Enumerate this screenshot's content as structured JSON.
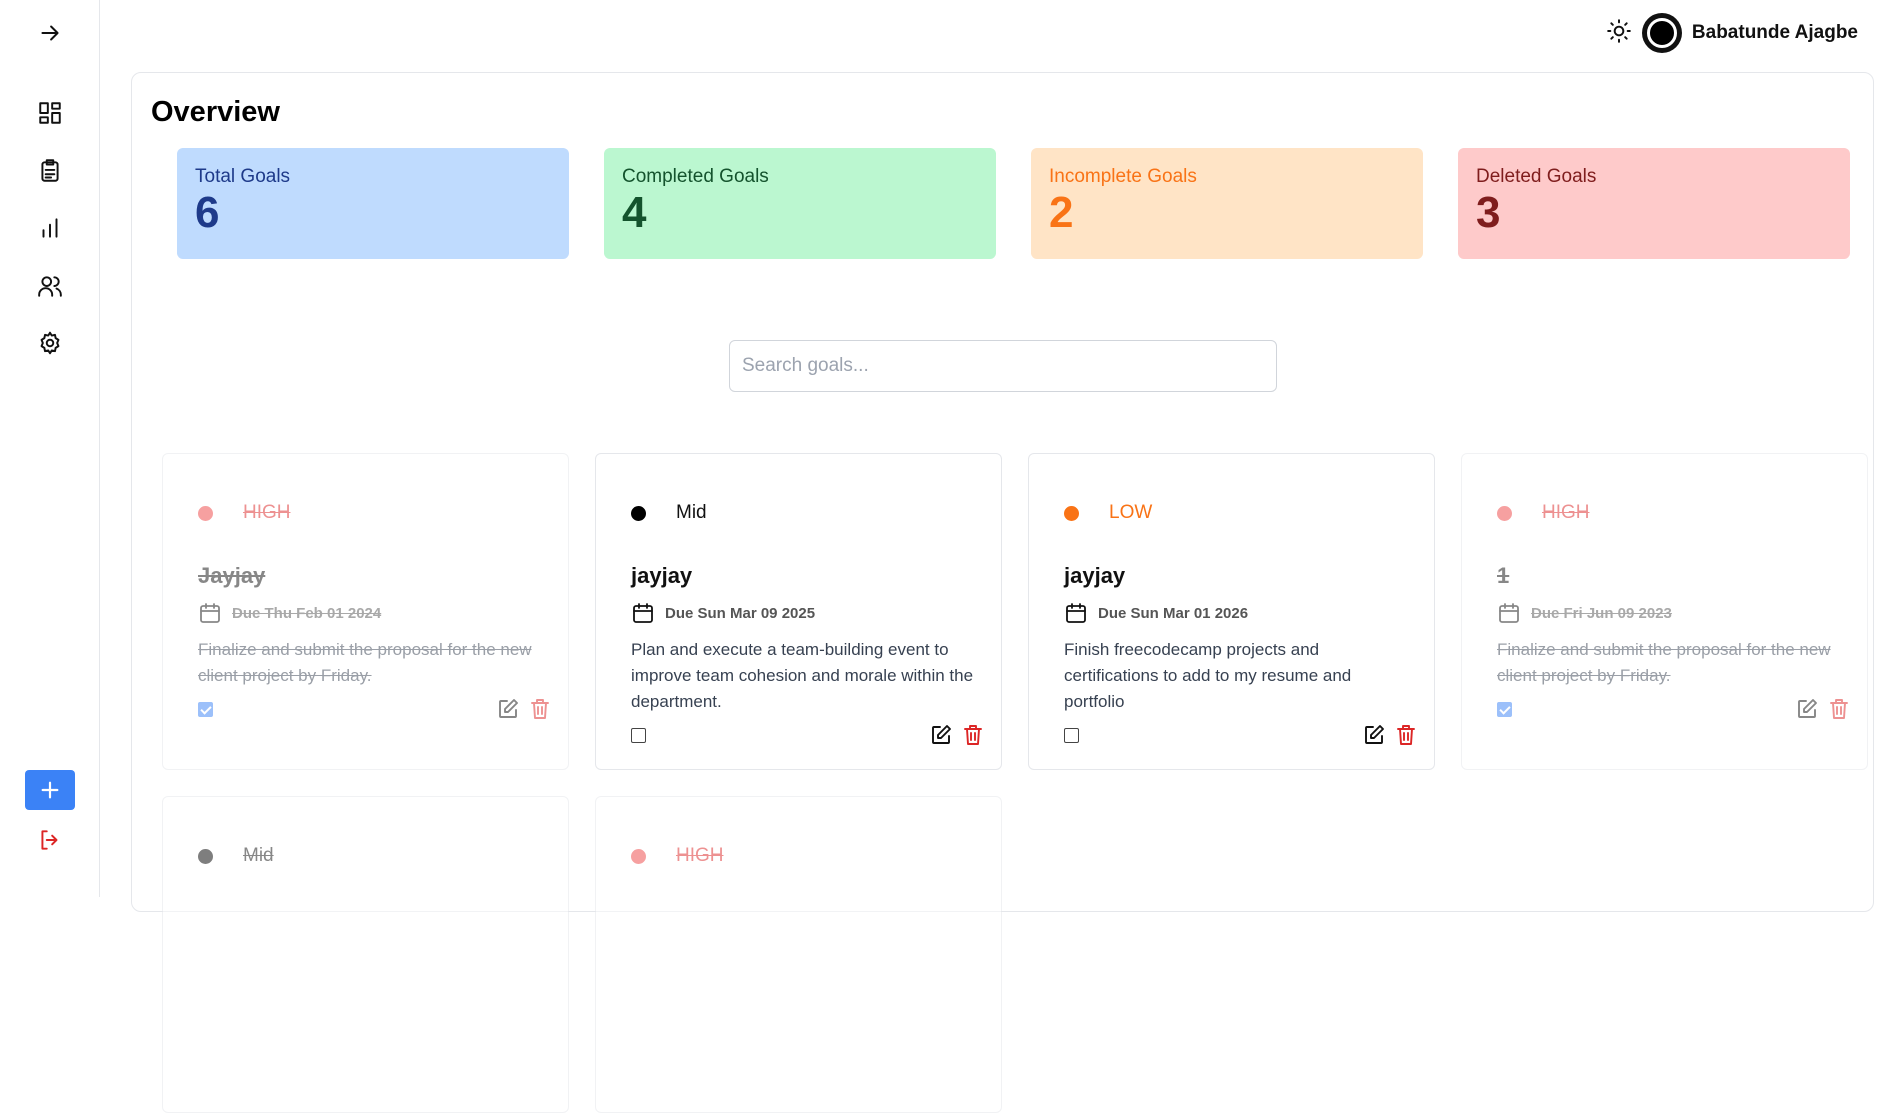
{
  "user": {
    "name": "Babatunde Ajagbe"
  },
  "overview": {
    "title": "Overview"
  },
  "stats": [
    {
      "label": "Total Goals",
      "value": "6",
      "bg": "#bfdbfe",
      "fg": "#1e3a8a"
    },
    {
      "label": "Completed Goals",
      "value": "4",
      "bg": "#bbf7d0",
      "fg": "#14532d"
    },
    {
      "label": "Incomplete Goals",
      "value": "2",
      "bg": "#ffe4c6",
      "fg": "#f97316"
    },
    {
      "label": "Deleted Goals",
      "value": "3",
      "bg": "#fecaca",
      "fg": "#7f1d1d"
    }
  ],
  "search": {
    "placeholder": "Search goals..."
  },
  "goals": [
    {
      "priority": "HIGH",
      "dot": "#ef4444",
      "prio_color": "#dc2626",
      "title": "Jayjay",
      "due": "Due Thu Feb 01 2024",
      "description": "Finalize and submit the proposal for the new client project by Friday.",
      "completed": true
    },
    {
      "priority": "Mid",
      "dot": "#000000",
      "prio_color": "#111111",
      "title": "jayjay",
      "due": "Due Sun Mar 09 2025",
      "description": "Plan and execute a team-building event to improve team cohesion and morale within the department.",
      "completed": false
    },
    {
      "priority": "LOW",
      "dot": "#f97316",
      "prio_color": "#f97316",
      "title": "jayjay",
      "due": "Due Sun Mar 01 2026",
      "description": "Finish freecodecamp projects and certifications to add to my resume and portfolio",
      "completed": false
    },
    {
      "priority": "HIGH",
      "dot": "#ef4444",
      "prio_color": "#dc2626",
      "title": "1",
      "due": "Due Fri Jun 09 2023",
      "description": "Finalize and submit the proposal for the new client project by Friday.",
      "completed": true
    },
    {
      "priority": "Mid",
      "dot": "#000000",
      "prio_color": "#111111",
      "completed": true
    },
    {
      "priority": "HIGH",
      "dot": "#ef4444",
      "prio_color": "#dc2626",
      "completed": true
    }
  ],
  "icons": {
    "sidebar": [
      "arrow-right-icon",
      "dashboard-icon",
      "clipboard-icon",
      "chart-icon",
      "users-icon",
      "settings-icon"
    ],
    "add": "plus-icon",
    "logout": "logout-icon",
    "theme": "sun-icon"
  }
}
